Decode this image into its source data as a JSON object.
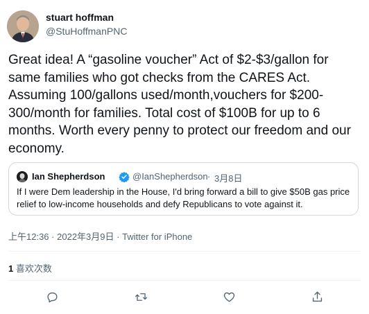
{
  "tweet": {
    "author_name": "stuart hoffman",
    "author_handle": "@StuHoffmanPNC",
    "text": "Great idea! A “gasoline voucher” Act of $2-$3/gallon for same families who got checks from the CARES Act. Assuming 100/gallons used/month,vouchers for $200-300/month for families. Total cost of $100B for up to 6 months. Worth every penny to protect our freedom and our economy.",
    "time": "上午12:36",
    "separator": "·",
    "date": "2022年3月9日",
    "source": "Twitter for iPhone",
    "like_count": "1",
    "like_label": " 喜欢次数"
  },
  "quote": {
    "author_name": "Ian Shepherdson",
    "author_handle": "@IanShepherdson",
    "separator": "·",
    "date": "3月8日",
    "text": "If I were Dem leadership in the House, I'd bring forward a bill to give $50B gas price relief to low-income households and defy Republicans to vote against it.",
    "verified": true
  },
  "actions": [
    "reply-icon",
    "retweet-icon",
    "like-icon",
    "share-icon"
  ],
  "colors": {
    "text": "#0f1419",
    "secondary": "#536471",
    "border": "#cfd9de",
    "verified": "#1d9bf0"
  }
}
